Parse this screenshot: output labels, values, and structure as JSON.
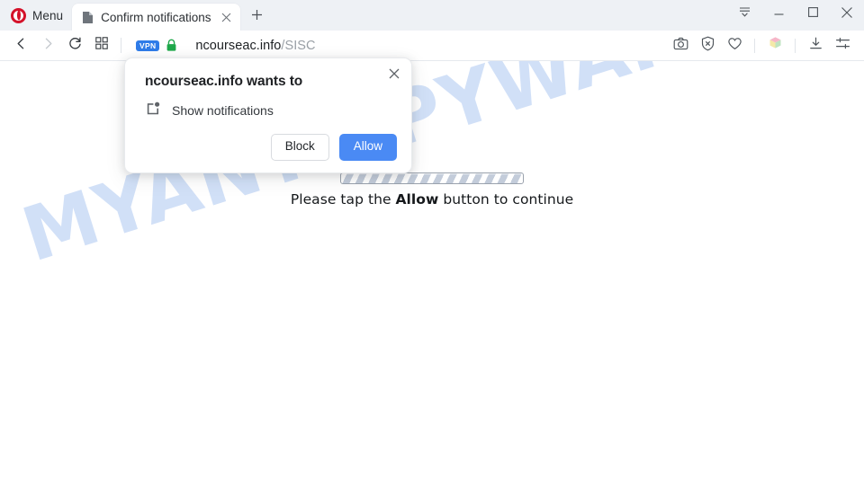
{
  "browser": {
    "menu_label": "Menu",
    "logo_icon": "opera-logo-icon",
    "tab": {
      "title": "Confirm notifications",
      "favicon_icon": "page-favicon-icon",
      "close_icon": "close-icon"
    },
    "new_tab_icon": "plus-icon",
    "window_controls": [
      {
        "name": "tab-list-button",
        "icon": "chevron-down-lines-icon"
      },
      {
        "name": "minimize-button",
        "icon": "minimize-icon"
      },
      {
        "name": "maximize-button",
        "icon": "maximize-icon"
      },
      {
        "name": "close-window-button",
        "icon": "close-icon"
      }
    ],
    "nav": {
      "back_icon": "chevron-left-icon",
      "forward_icon": "chevron-right-icon",
      "reload_icon": "reload-icon",
      "speeddial_icon": "grid-squares-icon"
    },
    "address": {
      "vpn_badge": "VPN",
      "lock_icon": "padlock-icon",
      "url_domain": "ncourseac.info",
      "url_path": "/SISC"
    },
    "toolbar_right": [
      {
        "name": "snapshot-button",
        "icon": "camera-icon"
      },
      {
        "name": "ad-blocker-button",
        "icon": "shield-x-icon"
      },
      {
        "name": "favorite-button",
        "icon": "heart-icon"
      },
      {
        "name": "extension-button",
        "icon": "cube-icon"
      },
      {
        "name": "downloads-button",
        "icon": "download-icon"
      },
      {
        "name": "easy-setup-button",
        "icon": "sliders-icon"
      }
    ]
  },
  "permission_dialog": {
    "title": "ncourseac.info wants to",
    "permission_icon": "notification-bell-icon",
    "permission_label": "Show notifications",
    "close_icon": "close-icon",
    "block_label": "Block",
    "allow_label": "Allow",
    "allow_color": "#4a8af4"
  },
  "page": {
    "watermark": "MYANTISPYWARE.COM",
    "watermark_color": "#cedef7",
    "progress_bar": "striped-progress-bar",
    "instruction_prefix": "Please tap the ",
    "instruction_bold": "Allow",
    "instruction_suffix": " button to continue"
  }
}
